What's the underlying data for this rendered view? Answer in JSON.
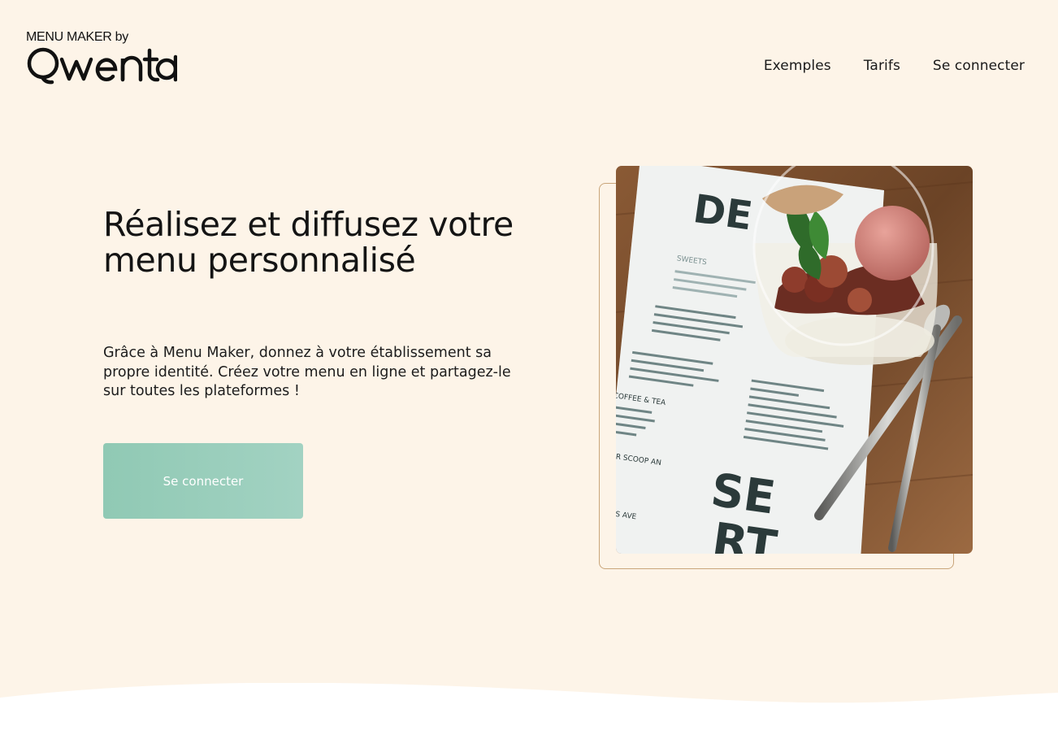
{
  "header": {
    "logo_small": "MENU MAKER by",
    "logo_brand": "Qwenta",
    "nav": [
      {
        "label": "Exemples"
      },
      {
        "label": "Tarifs"
      },
      {
        "label": "Se connecter"
      }
    ]
  },
  "hero": {
    "title": "Réalisez et diffusez votre menu personnalisé",
    "description": "Grâce à Menu Maker, donnez à votre établissement sa propre identité. Créez votre menu en ligne et partagez-le sur toutes les plateformes !",
    "cta_label": "Se connecter"
  },
  "photo": {
    "menu_heading_top": "DE",
    "menu_heading_bottom": [
      "SE",
      "RT"
    ],
    "menu_sections": {
      "sweets": "SWEETS",
      "coffee": "COFFEE & TEA",
      "scoop": "OUR SCOOP AN",
      "footer": "PRESS AVE"
    }
  },
  "colors": {
    "background": "#fdf4e8",
    "accent": "#99cfbc",
    "frame_border": "#c9a57a"
  }
}
